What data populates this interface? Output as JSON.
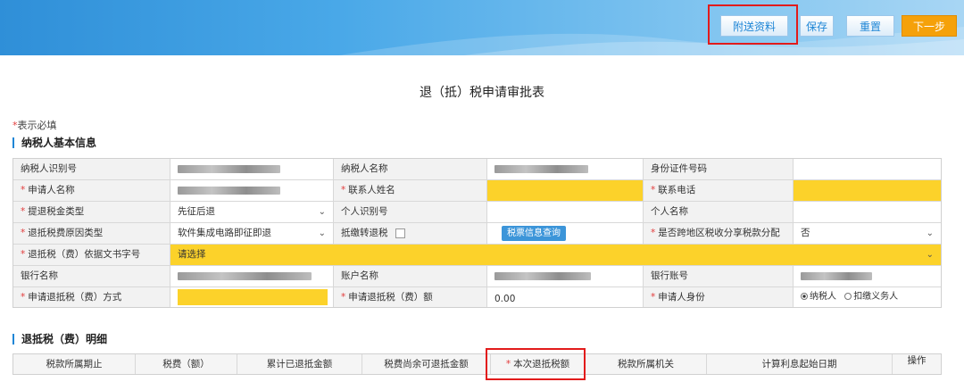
{
  "header": {
    "buttons": {
      "attach": "附送资料",
      "save": "保存",
      "reset": "重置",
      "next": "下一步"
    }
  },
  "page_title": "退（抵）税申请审批表",
  "required_note": {
    "star": "*",
    "text": "表示必填"
  },
  "section_basic": "纳税人基本信息",
  "section_detail": "退抵税（费）明细",
  "form": {
    "taxpayer_id_label": "纳税人识别号",
    "taxpayer_name_label": "纳税人名称",
    "id_doc_no_label": "身份证件号码",
    "applicant_name_label": "申请人名称",
    "contact_name_label": "联系人姓名",
    "contact_phone_label": "联系电话",
    "refund_type_label": "提退税金类型",
    "refund_type_value": "先征后退",
    "personal_id_label": "个人识别号",
    "personal_name_label": "个人名称",
    "refund_reason_label": "退抵税费原因类型",
    "refund_reason_value": "软件集成电路即征即退",
    "offset_label": "抵缴转退税",
    "tax_query_button": "税票信息查询",
    "cross_region_label": "是否跨地区税收分享税款分配",
    "cross_region_value": "否",
    "doc_no_label": "退抵税（费）依据文书字号",
    "doc_no_value": "请选择",
    "bank_name_label": "银行名称",
    "account_name_label": "账户名称",
    "bank_account_label": "银行账号",
    "refund_method_label": "申请退抵税（费）方式",
    "refund_amount_label": "申请退抵税（费）额",
    "refund_amount_value": "0.00",
    "applicant_identity_label": "申请人身份",
    "identity_options": [
      "纳税人",
      "扣缴义务人"
    ]
  },
  "detail_columns": [
    "税款所属期止",
    "税费（额）",
    "累计已退抵金额",
    "税费尚余可退抵金额",
    "本次退抵税额",
    "税款所属机关",
    "计算利息起始日期",
    "操作"
  ]
}
